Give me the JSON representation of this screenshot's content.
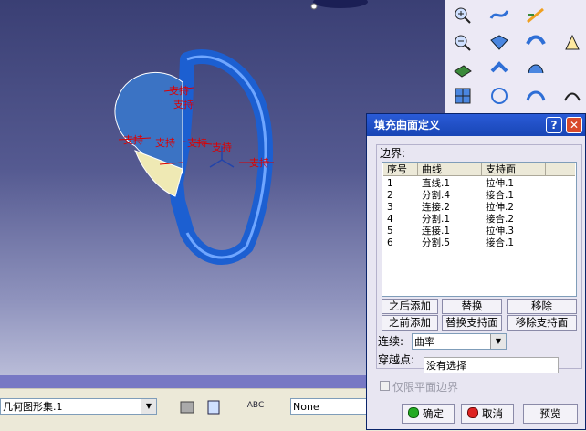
{
  "dialog": {
    "title": "填充曲面定义",
    "help": "?",
    "close": "✕",
    "boundary_label": "边界:",
    "columns": [
      "序号",
      "曲线",
      "支持面"
    ],
    "rows": [
      {
        "no": "1",
        "curve": "直线.1",
        "support": "拉伸.1"
      },
      {
        "no": "2",
        "curve": "分割.4",
        "support": "接合.1"
      },
      {
        "no": "3",
        "curve": "连接.2",
        "support": "拉伸.2"
      },
      {
        "no": "4",
        "curve": "分割.1",
        "support": "接合.2"
      },
      {
        "no": "5",
        "curve": "连接.1",
        "support": "拉伸.3"
      },
      {
        "no": "6",
        "curve": "分割.5",
        "support": "接合.1"
      }
    ],
    "buttons": {
      "add_after": "之后添加",
      "replace": "替换",
      "remove": "移除",
      "add_before": "之前添加",
      "replace_support": "替换支持面",
      "remove_support": "移除支持面"
    },
    "continuity_label": "连续:",
    "continuity_value": "曲率",
    "passing_point_label": "穿越点:",
    "passing_point_value": "没有选择",
    "planar_only_label": "仅限平面边界",
    "ok": "确定",
    "cancel": "取消",
    "preview": "预览"
  },
  "bottom_bar": {
    "geometric_set": "几何图形集.1",
    "none_field": "None",
    "abc_icon": "ABC"
  },
  "viewport_labels": [
    {
      "text": "支持",
      "color": "#dd0000"
    },
    {
      "text": "支持",
      "color": "#dd0000"
    },
    {
      "text": "支持",
      "color": "#dd0000"
    },
    {
      "text": "支持",
      "color": "#dd0000"
    },
    {
      "text": "支持",
      "color": "#dd0000"
    },
    {
      "text": "支持",
      "color": "#dd0000"
    },
    {
      "text": "支持",
      "color": "#dd0000"
    }
  ],
  "colors": {
    "title_bar": "#1845b5",
    "viewport_top": "#3a3f74",
    "accent_red": "#dd0000",
    "part_blue": "#2f6fd6"
  },
  "toolbar_icons": [
    "zoom-in-icon",
    "spline-icon",
    "draw-curve-icon",
    "zoom-out-icon",
    "surface-icon",
    "sweep-icon",
    "plane-icon",
    "offset-icon",
    "fill-icon",
    "grid-icon",
    "circle-icon",
    "blend-icon"
  ]
}
